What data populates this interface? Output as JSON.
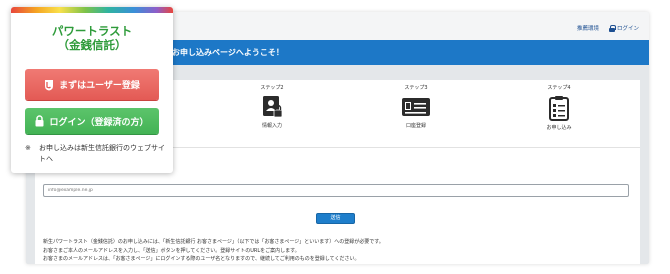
{
  "top_links": {
    "points_label": "推薦環境",
    "login_label": "ログイン"
  },
  "banner": {
    "title": "お申し込みページへようこそ！"
  },
  "steps": [
    {
      "title": "ステップ2",
      "label": "情報入力",
      "icon": "id-card-lock-icon"
    },
    {
      "title": "ステップ3",
      "label": "口座登録",
      "icon": "bank-card-icon"
    },
    {
      "title": "ステップ4",
      "label": "お申し込み",
      "icon": "clipboard-checklist-icon"
    }
  ],
  "email": {
    "placeholder": "info@example.ne.jp"
  },
  "submit_label": "送信",
  "description": [
    "新生パワートラスト（金銭信託）のお申し込みには、「新生信託銀行 お客さまページ」（以下では「お客さまページ」といいます）への登録が必要です。",
    "お客さまご本人のメールアドレスを入力し、「送信」ボタンを押してください。登録サイトのURLをご案内します。",
    "お客さまのメールアドレスは、「お客さまページ」にログインする際のユーザ名となりますので、継続してご利用のものを登録してください。"
  ],
  "card": {
    "title_line1": "パワートラスト",
    "title_line2": "（金銭信託）",
    "register_label": "まずはユーザー登録",
    "login_label": "ログイン（登録済の方）",
    "note_mark": "※",
    "note_text": "お申し込みは新生信託銀行のウェブサイトへ"
  },
  "colors": {
    "brand_green": "#2e9b3a",
    "register_red": "#e35a55",
    "login_green": "#43b355",
    "banner_blue": "#1d78c7"
  }
}
